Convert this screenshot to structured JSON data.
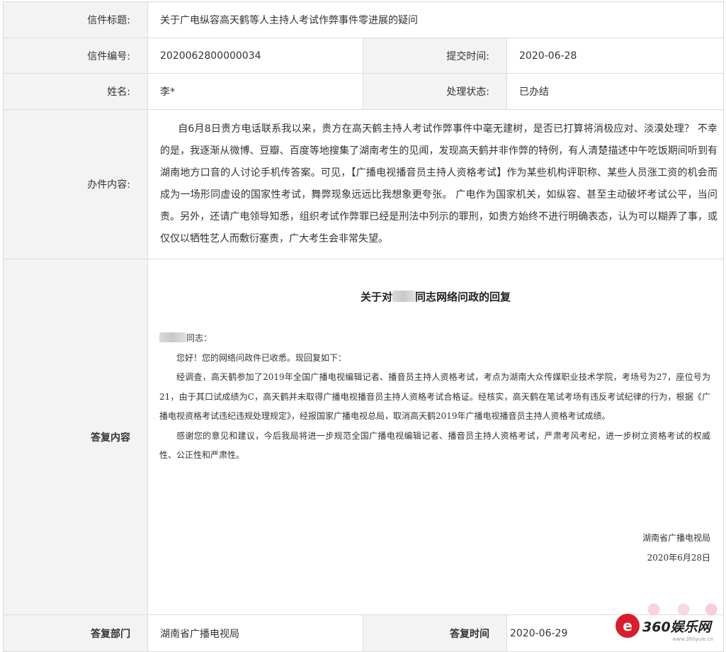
{
  "letter": {
    "title_label": "信件标题:",
    "title_value": "关于广电纵容高天鹤等人主持人考试作弊事件零进展的疑问",
    "number_label": "信件编号:",
    "number_value": "2020062800000034",
    "submit_time_label": "提交时间:",
    "submit_time_value": "2020-06-28",
    "name_label": "姓名:",
    "name_value": "李*",
    "status_label": "处理状态:",
    "status_value": "已办结",
    "content_label": "办件内容:",
    "content_value": "自6月8日贵方电话联系我以来，贵方在高天鹤主持人考试作弊事件中毫无建树，是否已打算将消极应对、淡漠处理？ 不幸的是，我逐渐从微博、豆瓣、百度等地搜集了湖南考生的见闻，发现高天鹤并非作弊的特例，有人清楚描述中午吃饭期间听到有湖南地方口音的人讨论手机传答案。可见，【广播电视播音员主持人资格考试】作为某些机构评职称、某些人员涨工资的机会而成为一场形同虚设的国家性考试，舞弊现象远远比我想象更夸张。 广电作为国家机关，如纵容、甚至主动破坏考试公平，当问责。另外，还请广电领导知悉，组织考试作弊罪已经是刑法中列示的罪刑，如贵方始终不进行明确表态，认为可以糊弄了事，或仅仅以牺牲艺人而敷衍塞责，广大考生会非常失望。"
  },
  "reply": {
    "label": "答复内容",
    "title_prefix": "关于对",
    "title_suffix": "同志网络问政的回复",
    "salutation_suffix": "同志：",
    "para1": "您好！您的网络问政件已收悉。现回复如下：",
    "para2": "经调查，高天鹤参加了2019年全国广播电视编辑记者、播音员主持人资格考试，考点为湖南大众传媒职业技术学院，考场号为27，座位号为21，由于其口试成绩为C，高天鹤并未取得广播电视播音员主持人资格考试合格证。经核实，高天鹤在笔试考场有违反考试纪律的行为，根据《广播电视资格考试违纪违规处理规定》，经报国家广播电视总局，取消高天鹤2019年广播电视播音员主持人资格考试成绩。",
    "para3": "感谢您的意见和建议，今后我局将进一步规范全国广播电视编辑记者、播音员主持人资格考试，严肃考风考纪，进一步树立资格考试的权威性、公正性和严肃性。",
    "signature": "湖南省广播电视局",
    "date": "2020年6月28日",
    "dept_label": "答复部门",
    "dept_value": "湖南省广播电视局",
    "time_label": "答复时间",
    "time_value": "2020-06-29"
  },
  "watermark": {
    "logo_glyph": "e",
    "text": "360娱乐网",
    "url": "www.360yule.cn"
  }
}
